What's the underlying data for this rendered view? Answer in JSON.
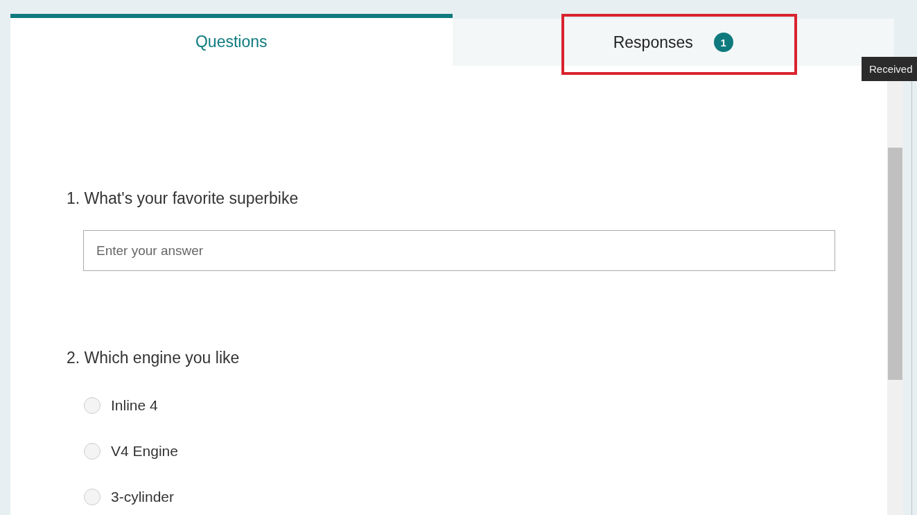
{
  "tabs": [
    {
      "label": "Questions",
      "selected": true
    },
    {
      "label": "Responses",
      "selected": false,
      "badge": "1"
    }
  ],
  "highlight_box": true,
  "tooltip": {
    "text": "Received"
  },
  "questions": [
    {
      "kind": "text",
      "number": "1.",
      "title": "What's your favorite superbike",
      "placeholder": "Enter your answer"
    },
    {
      "kind": "choice",
      "number": "2.",
      "title": "Which engine you like",
      "options": [
        {
          "label": "Inline 4",
          "selected": false
        },
        {
          "label": "V4 Engine",
          "selected": false
        },
        {
          "label": "3-cylinder",
          "selected": false
        }
      ]
    }
  ]
}
